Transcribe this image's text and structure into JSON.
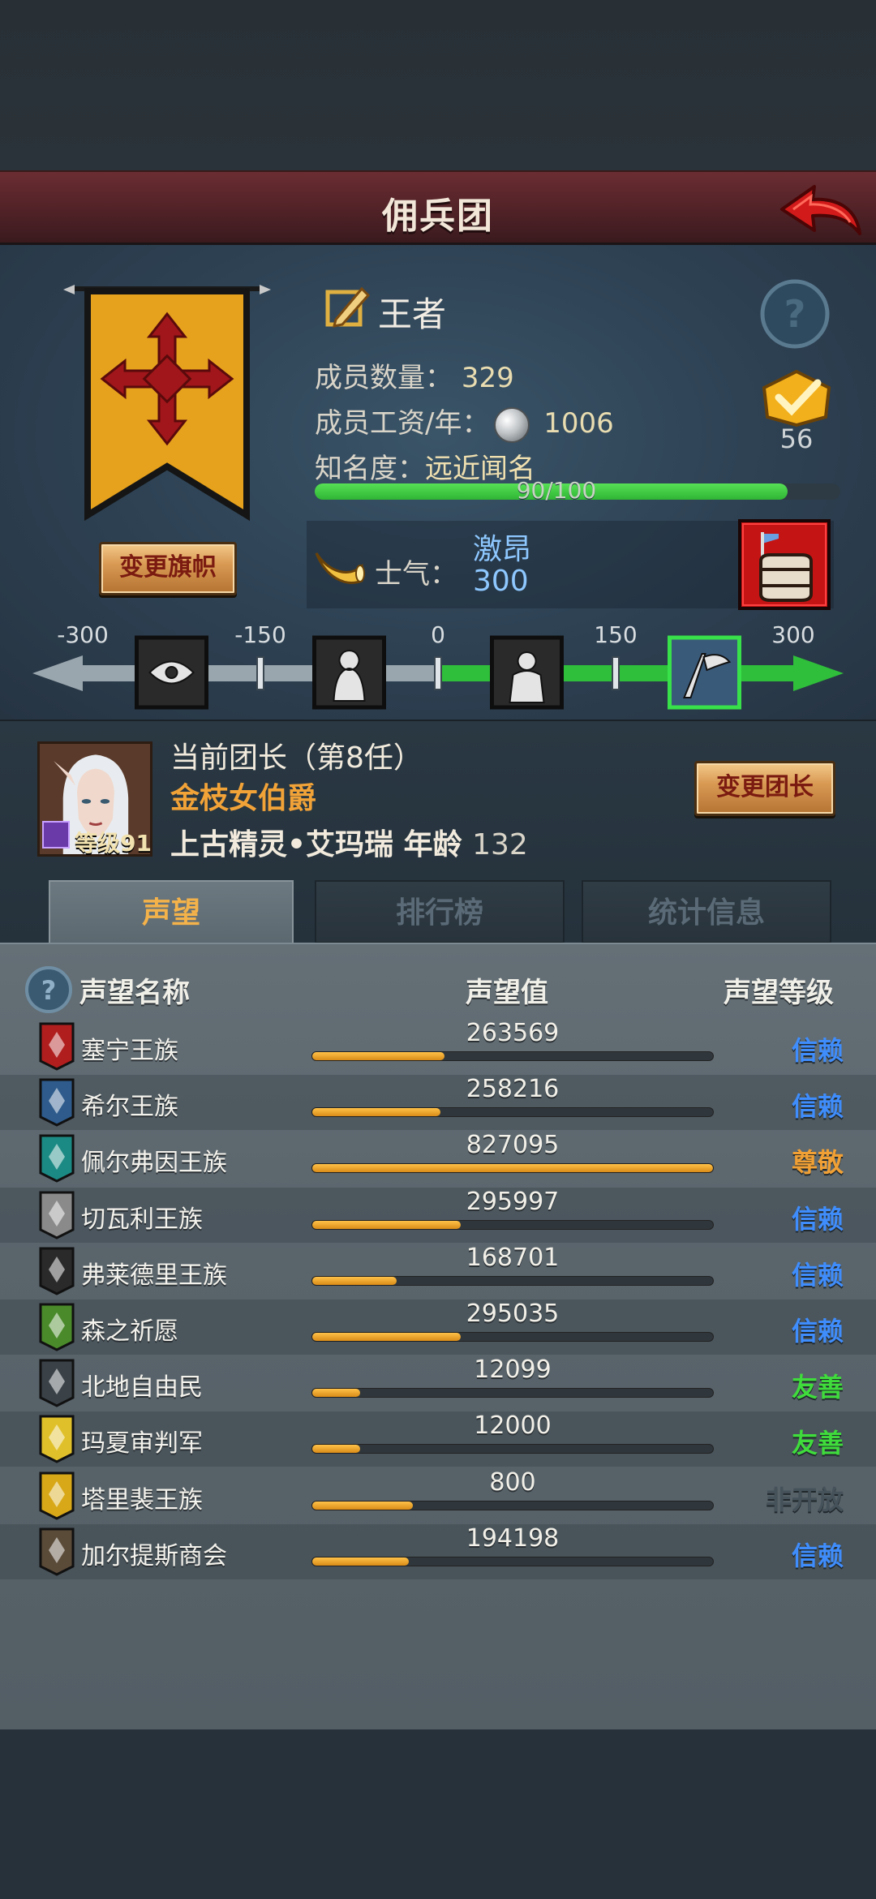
{
  "header": {
    "title": "佣兵团"
  },
  "guild": {
    "change_flag_label": "变更旗帜",
    "rank_name": "王者",
    "members_label": "成员数量：",
    "members_value": "329",
    "wage_label": "成员工资/年：",
    "wage_value": "1006",
    "fame_label": "知名度：",
    "fame_value": "远近闻名",
    "fame_progress_text": "90/100",
    "fame_progress": 0.9,
    "level": "56"
  },
  "morale": {
    "label": "士气：",
    "state": "激昂",
    "value": "300",
    "scale_labels": [
      "-300",
      "-150",
      "0",
      "150",
      "300"
    ],
    "scale_min": -300,
    "scale_max": 300,
    "current": 300,
    "status_icons": [
      "eye-icon",
      "despair-figure-icon",
      "calm-figure-icon",
      "victory-banner-icon"
    ],
    "active_status": 3
  },
  "leader": {
    "title": "当前团长（第8任）",
    "rank": "金枝女伯爵",
    "name": "上古精灵•艾玛瑞",
    "age_label": "年龄",
    "age": "132",
    "level_text": "等级91",
    "change_label": "变更团长"
  },
  "tabs": {
    "reputation": "声望",
    "ranking": "排行榜",
    "stats": "统计信息"
  },
  "reputation": {
    "col_name": "声望名称",
    "col_value": "声望值",
    "col_level": "声望等级",
    "level_colors": {
      "信赖": "#3f8dfc",
      "尊敬": "#f0a035",
      "友善": "#3fdc3c",
      "非开放": "#46525a"
    },
    "rows": [
      {
        "name": "塞宁王族",
        "value": "263569",
        "fill": 0.33,
        "level": "信赖",
        "icon": "red-lion-crest-icon",
        "icon_color": "#b01e1e"
      },
      {
        "name": "希尔王族",
        "value": "258216",
        "fill": 0.32,
        "level": "信赖",
        "icon": "blue-tower-crest-icon",
        "icon_color": "#2e5b8c"
      },
      {
        "name": "佩尔弗因王族",
        "value": "827095",
        "fill": 1.0,
        "level": "尊敬",
        "icon": "teal-moon-crest-icon",
        "icon_color": "#1c8a84"
      },
      {
        "name": "切瓦利王族",
        "value": "295997",
        "fill": 0.37,
        "level": "信赖",
        "icon": "scales-crest-icon",
        "icon_color": "#8a8a8a"
      },
      {
        "name": "弗莱德里王族",
        "value": "168701",
        "fill": 0.21,
        "level": "信赖",
        "icon": "dark-beast-crest-icon",
        "icon_color": "#2a2a2a"
      },
      {
        "name": "森之祈愿",
        "value": "295035",
        "fill": 0.37,
        "level": "信赖",
        "icon": "green-tree-crest-icon",
        "icon_color": "#4a8a2a"
      },
      {
        "name": "北地自由民",
        "value": "12099",
        "fill": 0.12,
        "level": "友善",
        "icon": "axe-crest-icon",
        "icon_color": "#3a4248"
      },
      {
        "name": "玛夏审判军",
        "value": "12000",
        "fill": 0.12,
        "level": "友善",
        "icon": "yellow-sun-crest-icon",
        "icon_color": "#e0c02a"
      },
      {
        "name": "塔里裴王族",
        "value": "800",
        "fill": 0.25,
        "level": "非开放",
        "icon": "gold-crown-crest-icon",
        "icon_color": "#d8a818"
      },
      {
        "name": "加尔提斯商会",
        "value": "194198",
        "fill": 0.24,
        "level": "信赖",
        "icon": "chest-crest-icon",
        "icon_color": "#5a4a38"
      }
    ]
  }
}
